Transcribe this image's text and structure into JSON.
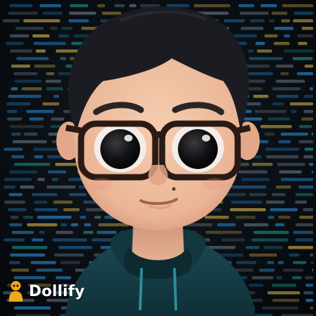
{
  "image": {
    "description_free": true,
    "background": "code-screen",
    "colors": {
      "background": "#0b0f14",
      "code_blue": "#2a8fd8",
      "code_teal": "#1fa39b",
      "code_yellow": "#d8b64a",
      "code_gray": "#6b7a86",
      "skin": "#f0c3a4",
      "skin_shadow": "#dc9f82",
      "hair": "#1b1c22",
      "glasses": "#2a1a14",
      "hoodie": "#15404a",
      "hoodie_dark": "#0f2f37",
      "watermark_icon": "#f3a81b"
    }
  },
  "watermark": {
    "text": "Dollify",
    "icon": "dollify-logo-icon"
  }
}
